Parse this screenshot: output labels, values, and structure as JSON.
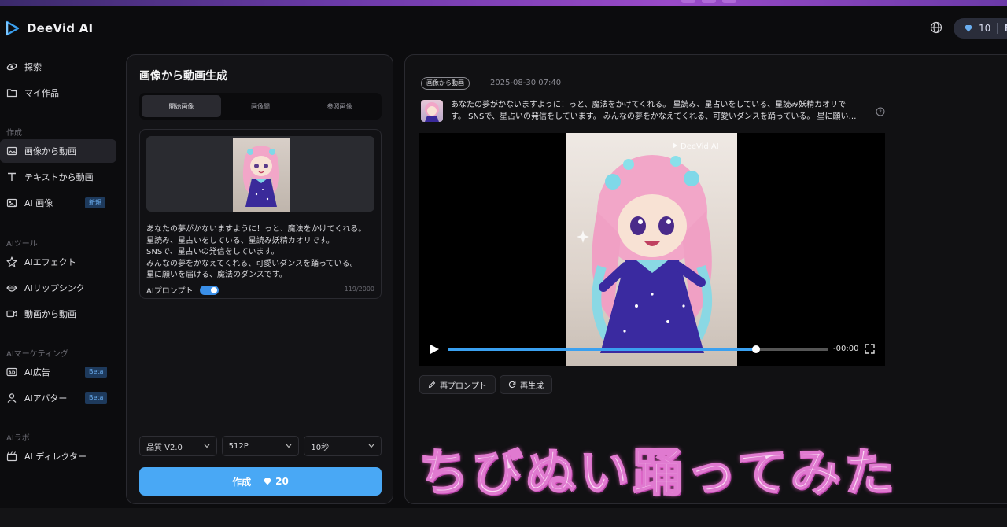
{
  "app": {
    "brand": "DeeVid AI",
    "credits": "10",
    "credits_suffix": "F"
  },
  "sidebar": {
    "items": [
      {
        "label": "探索",
        "icon": "explore-icon"
      },
      {
        "label": "マイ作品",
        "icon": "folder-icon"
      }
    ],
    "sections": [
      {
        "title": "作成",
        "items": [
          {
            "label": "画像から動画",
            "icon": "image-icon",
            "active": true
          },
          {
            "label": "テキストから動画",
            "icon": "text-icon"
          },
          {
            "label": "AI 画像",
            "icon": "ai-image-icon",
            "badge": "新規"
          }
        ]
      },
      {
        "title": "AIツール",
        "items": [
          {
            "label": "AIエフェクト",
            "icon": "sparkle-icon"
          },
          {
            "label": "AIリップシンク",
            "icon": "lips-icon"
          },
          {
            "label": "動画から動画",
            "icon": "video-icon"
          }
        ]
      },
      {
        "title": "AIマーケティング",
        "items": [
          {
            "label": "AI広告",
            "icon": "ad-icon",
            "badge": "Beta"
          },
          {
            "label": "AIアバター",
            "icon": "avatar-icon",
            "badge": "Beta"
          }
        ]
      },
      {
        "title": "AIラボ",
        "items": [
          {
            "label": "AI ディレクター",
            "icon": "director-icon"
          }
        ]
      }
    ]
  },
  "left_panel": {
    "title": "画像から動画生成",
    "tabs": [
      "開始画像",
      "画像間",
      "参照画像"
    ],
    "prompt_lines": [
      "あなたの夢がかないますように！っと、魔法をかけてくれる。",
      "星読み、星占いをしている、星読み妖精カオリです。",
      "SNSで、星占いの発信をしています。",
      "みんなの夢をかなえてくれる、可愛いダンスを踊っている。",
      "星に願いを届ける、魔法のダンスです。"
    ],
    "ai_prompt_label": "AIプロンプト",
    "char_count": "119/2000",
    "quality": "品質 V2.0",
    "resolution": "512P",
    "duration": "10秒",
    "create_label": "作成",
    "create_cost": "20"
  },
  "right_panel": {
    "tag": "画像から動画",
    "date": "2025-08-30 07:40",
    "desc_line1": "あなたの夢がかないますように！っと、魔法をかけてくれる。 星読み、星占いをしている、星読み妖精カオリで",
    "desc_line2": "す。 SNSで、星占いの発信をしています。 みんなの夢をかなえてくれる、可愛いダンスを踊っている。 星に願い…",
    "watermark": "DeeVid AI",
    "time": "-00:00",
    "progress": 0.81,
    "reprompt_label": "再プロンプト",
    "regen_label": "再生成"
  },
  "overlay": {
    "text": "ちびぬい踊ってみた"
  },
  "colors": {
    "accent": "#49a8f5",
    "overlay": "#f9d8f2"
  }
}
